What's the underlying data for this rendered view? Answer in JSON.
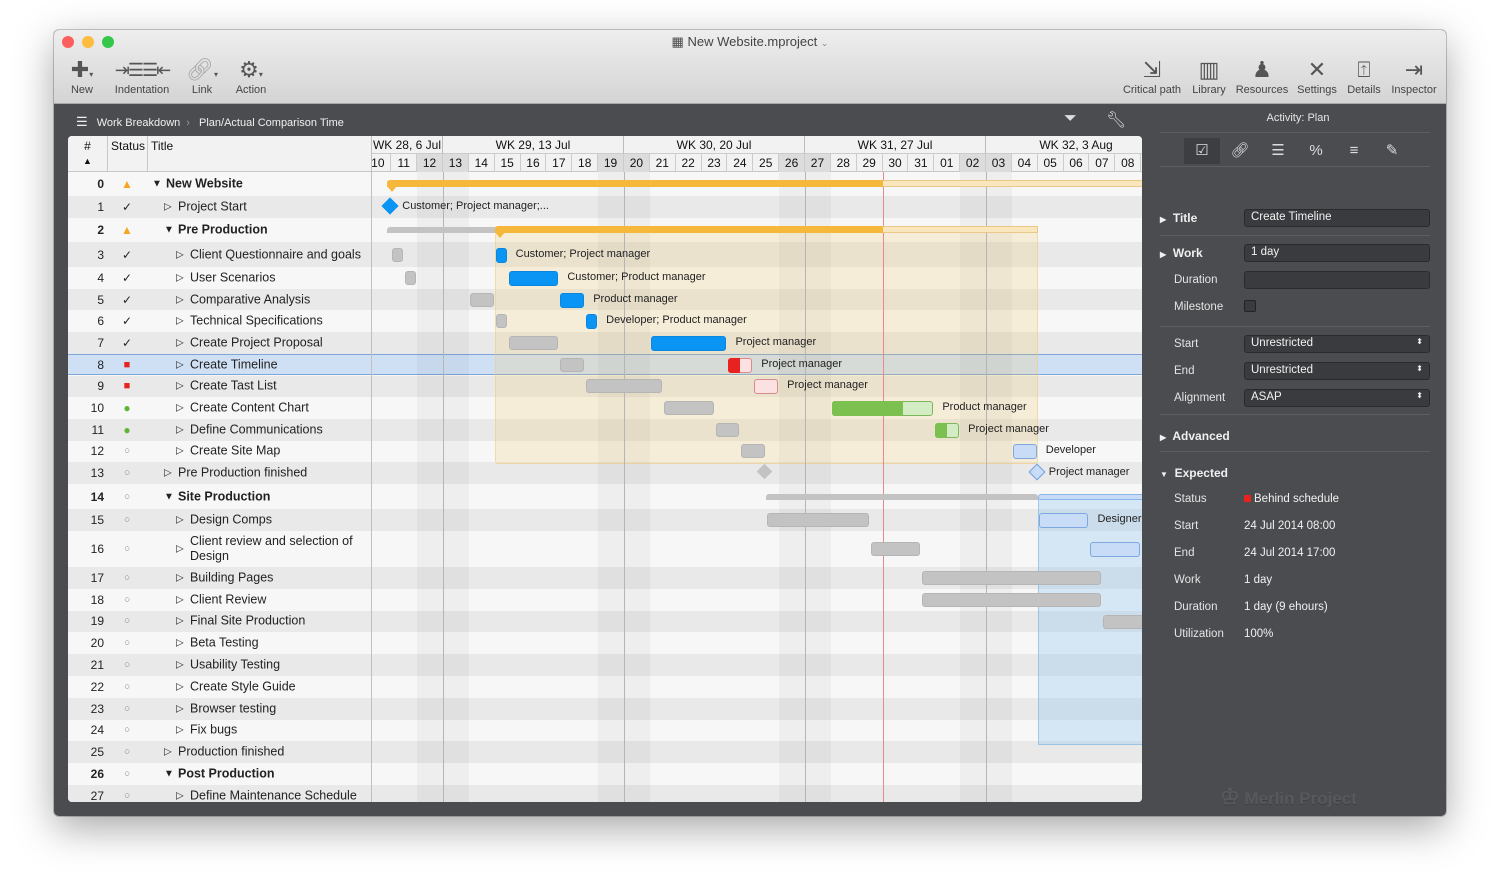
{
  "window": {
    "title": "New Website.mproject",
    "controls": {
      "close": "#fc605c",
      "minimize": "#fdbc40",
      "zoom": "#34c84a"
    }
  },
  "toolbar": {
    "left": [
      {
        "label": "New",
        "icon": "plus-icon"
      },
      {
        "label": "Indentation",
        "icon": "indent-icon"
      },
      {
        "label": "Link",
        "icon": "link-icon"
      },
      {
        "label": "Action",
        "icon": "gear-icon"
      }
    ],
    "right": [
      {
        "label": "Critical path",
        "icon": "critical-path-icon"
      },
      {
        "label": "Library",
        "icon": "library-icon"
      },
      {
        "label": "Resources",
        "icon": "person-icon"
      },
      {
        "label": "Settings",
        "icon": "tools-icon"
      },
      {
        "label": "Details",
        "icon": "details-icon"
      },
      {
        "label": "Inspector",
        "icon": "inspector-icon"
      }
    ]
  },
  "breadcrumb": [
    "Work Breakdown",
    "Plan/Actual Comparison Time"
  ],
  "outline": {
    "headers": {
      "num": "#",
      "status": "Status",
      "title": "Title"
    },
    "rows": [
      {
        "n": "0",
        "status": "warning",
        "title": "New Website",
        "level": 0,
        "group": true,
        "bold": true
      },
      {
        "n": "1",
        "status": "check",
        "title": "Project Start",
        "level": 1
      },
      {
        "n": "2",
        "status": "warning",
        "title": "Pre Production",
        "level": 1,
        "group": true,
        "bold": true
      },
      {
        "n": "3",
        "status": "check",
        "title": "Client Questionnaire and goals",
        "level": 2
      },
      {
        "n": "4",
        "status": "check",
        "title": "User Scenarios",
        "level": 2
      },
      {
        "n": "5",
        "status": "check",
        "title": "Comparative Analysis",
        "level": 2
      },
      {
        "n": "6",
        "status": "check",
        "title": "Technical Specifications",
        "level": 2
      },
      {
        "n": "7",
        "status": "check",
        "title": "Create Project Proposal",
        "level": 2
      },
      {
        "n": "8",
        "status": "behind",
        "title": "Create Timeline",
        "level": 2,
        "selected": true
      },
      {
        "n": "9",
        "status": "behind",
        "title": "Create Tast List",
        "level": 2
      },
      {
        "n": "10",
        "status": "ontrack",
        "title": "Create Content Chart",
        "level": 2
      },
      {
        "n": "11",
        "status": "ontrack",
        "title": "Define Communications",
        "level": 2
      },
      {
        "n": "12",
        "status": "open",
        "title": "Create Site Map",
        "level": 2
      },
      {
        "n": "13",
        "status": "open",
        "title": "Pre Production finished",
        "level": 1
      },
      {
        "n": "14",
        "status": "open",
        "title": "Site Production",
        "level": 1,
        "group": true,
        "bold": true
      },
      {
        "n": "15",
        "status": "open",
        "title": "Design Comps",
        "level": 2
      },
      {
        "n": "16",
        "status": "open",
        "title": "Client review and selection of Design",
        "level": 2
      },
      {
        "n": "17",
        "status": "open",
        "title": "Building Pages",
        "level": 2
      },
      {
        "n": "18",
        "status": "open",
        "title": "Client Review",
        "level": 2
      },
      {
        "n": "19",
        "status": "open",
        "title": "Final Site Production",
        "level": 2
      },
      {
        "n": "20",
        "status": "open",
        "title": "Beta Testing",
        "level": 2
      },
      {
        "n": "21",
        "status": "open",
        "title": "Usability Testing",
        "level": 2
      },
      {
        "n": "22",
        "status": "open",
        "title": "Create Style Guide",
        "level": 2
      },
      {
        "n": "23",
        "status": "open",
        "title": "Browser testing",
        "level": 2
      },
      {
        "n": "24",
        "status": "open",
        "title": "Fix bugs",
        "level": 2
      },
      {
        "n": "25",
        "status": "open",
        "title": "Production finished",
        "level": 1
      },
      {
        "n": "26",
        "status": "open",
        "title": "Post Production",
        "level": 1,
        "group": true,
        "bold": true
      },
      {
        "n": "27",
        "status": "open",
        "title": "Define Maintenance Schedule",
        "level": 2
      }
    ]
  },
  "timeline": {
    "weeks": [
      "WK 28, 6 Jul",
      "WK 29, 13 Jul",
      "WK 30, 20 Jul",
      "WK 31, 27 Jul",
      "WK 32, 3 Aug"
    ],
    "days": [
      "10",
      "11",
      "12",
      "13",
      "14",
      "15",
      "16",
      "17",
      "18",
      "19",
      "20",
      "21",
      "22",
      "23",
      "24",
      "25",
      "26",
      "27",
      "28",
      "29",
      "30",
      "31",
      "01",
      "02",
      "03",
      "04",
      "05",
      "06",
      "07",
      "08"
    ],
    "weekend_days": [
      "12",
      "13",
      "19",
      "20",
      "26",
      "27",
      "02",
      "03"
    ],
    "today": "2014-07-30",
    "colors": {
      "done": "#0a95f5",
      "behind": "#e8231f",
      "ontrack": "#7cc04f",
      "future": "#c9dcf7",
      "baseline": "#c3c3c3",
      "summary": "#f6b83a"
    },
    "bars": [
      {
        "row": 0,
        "type": "summary",
        "start": "2014-07-10T20:00",
        "end": "2014-08-10T00:00",
        "progress_until": "2014-07-30"
      },
      {
        "row": 1,
        "type": "milestone",
        "at": "2014-07-11",
        "state": "done",
        "label": "Customer; Project manager;..."
      },
      {
        "row": 2,
        "type": "summary",
        "baseline": [
          "2014-07-10T20:00",
          "2014-07-25T12:00"
        ],
        "start": "2014-07-15",
        "end": "2014-08-05",
        "progress_until": "2014-07-30"
      },
      {
        "row": 3,
        "baseline": [
          "2014-07-11",
          "2014-07-11T12:00"
        ],
        "start": "2014-07-15",
        "end": "2014-07-15T12:00",
        "state": "done",
        "label": "Customer; Project manager"
      },
      {
        "row": 4,
        "baseline": [
          "2014-07-11T12:00",
          "2014-07-12"
        ],
        "start": "2014-07-15T12:00",
        "end": "2014-07-17T12:00",
        "state": "done",
        "label": "Customer; Product manager"
      },
      {
        "row": 5,
        "baseline": [
          "2014-07-14",
          "2014-07-15"
        ],
        "start": "2014-07-17T12:00",
        "end": "2014-07-18T12:00",
        "state": "done",
        "label": "Product manager"
      },
      {
        "row": 6,
        "baseline": [
          "2014-07-15",
          "2014-07-15T12:00"
        ],
        "start": "2014-07-18T12:00",
        "end": "2014-07-19",
        "state": "done",
        "label": "Developer; Product manager"
      },
      {
        "row": 7,
        "baseline": [
          "2014-07-15T12:00",
          "2014-07-17T12:00"
        ],
        "start": "2014-07-21",
        "end": "2014-07-24",
        "state": "done",
        "label": "Project manager"
      },
      {
        "row": 8,
        "baseline": [
          "2014-07-17T12:00",
          "2014-07-18T12:00"
        ],
        "start": "2014-07-24",
        "end": "2014-07-25",
        "state": "behind",
        "progress": 0.5,
        "label": "Project manager"
      },
      {
        "row": 9,
        "baseline": [
          "2014-07-18T12:00",
          "2014-07-21T12:00"
        ],
        "start": "2014-07-25",
        "end": "2014-07-26",
        "state": "behind",
        "progress": 0,
        "label": "Project manager"
      },
      {
        "row": 10,
        "baseline": [
          "2014-07-21T12:00",
          "2014-07-23T12:00"
        ],
        "start": "2014-07-28",
        "end": "2014-08-01",
        "state": "ontrack",
        "progress": 0.7,
        "label": "Product manager"
      },
      {
        "row": 11,
        "baseline": [
          "2014-07-23T12:00",
          "2014-07-24T12:00"
        ],
        "start": "2014-08-01",
        "end": "2014-08-02",
        "state": "ontrack",
        "progress": 0.5,
        "label": "Project manager"
      },
      {
        "row": 12,
        "baseline": [
          "2014-07-24T12:00",
          "2014-07-25T12:00"
        ],
        "start": "2014-08-04",
        "end": "2014-08-05",
        "state": "future",
        "label": "Developer"
      },
      {
        "row": 13,
        "type": "milestone",
        "baseline_at": "2014-07-25T12:00",
        "at": "2014-08-05",
        "state": "future",
        "label": "Project manager"
      },
      {
        "row": 14,
        "type": "summary",
        "baseline": [
          "2014-07-25T12:00",
          "2014-08-05"
        ],
        "start": "2014-08-05",
        "end": "2014-08-20",
        "state": "future"
      },
      {
        "row": 15,
        "baseline": [
          "2014-07-25T12:00",
          "2014-07-29T12:00"
        ],
        "start": "2014-08-05",
        "end": "2014-08-07",
        "state": "future",
        "label": "Designer"
      },
      {
        "row": 16,
        "baseline": [
          "2014-07-29T12:00",
          "2014-07-31T12:00"
        ],
        "start": "2014-08-07",
        "end": "2014-08-09",
        "state": "future"
      },
      {
        "row": 17,
        "baseline": [
          "2014-07-31T12:00",
          "2014-08-07T12:00"
        ]
      },
      {
        "row": 18,
        "baseline": [
          "2014-07-31T12:00",
          "2014-08-07T12:00"
        ]
      },
      {
        "row": 19,
        "baseline": [
          "2014-08-07T12:00",
          "2014-08-10"
        ]
      }
    ]
  },
  "inspector": {
    "header": "Activity: Plan",
    "tabs": [
      "activity-icon",
      "link-icon",
      "cost-icon",
      "percent-icon",
      "list-icon",
      "notes-icon"
    ],
    "title": {
      "label": "Title",
      "value": "Create Timeline"
    },
    "work": {
      "label": "Work",
      "value": "1 day"
    },
    "duration": {
      "label": "Duration",
      "value": ""
    },
    "milestone": {
      "label": "Milestone",
      "checked": false
    },
    "start": {
      "label": "Start",
      "value": "Unrestricted"
    },
    "end": {
      "label": "End",
      "value": "Unrestricted"
    },
    "alignment": {
      "label": "Alignment",
      "value": "ASAP"
    },
    "advanced": "Advanced",
    "expected": {
      "label": "Expected",
      "status": {
        "label": "Status",
        "value": "Behind schedule",
        "color": "#e8231f"
      },
      "start": {
        "label": "Start",
        "value": "24 Jul 2014 08:00"
      },
      "end": {
        "label": "End",
        "value": "24 Jul 2014 17:00"
      },
      "work": {
        "label": "Work",
        "value": "1 day"
      },
      "duration": {
        "label": "Duration",
        "value": "1 day (9 ehours)"
      },
      "utilization": {
        "label": "Utilization",
        "value": "100%"
      }
    }
  },
  "watermark": "Merlin Project"
}
